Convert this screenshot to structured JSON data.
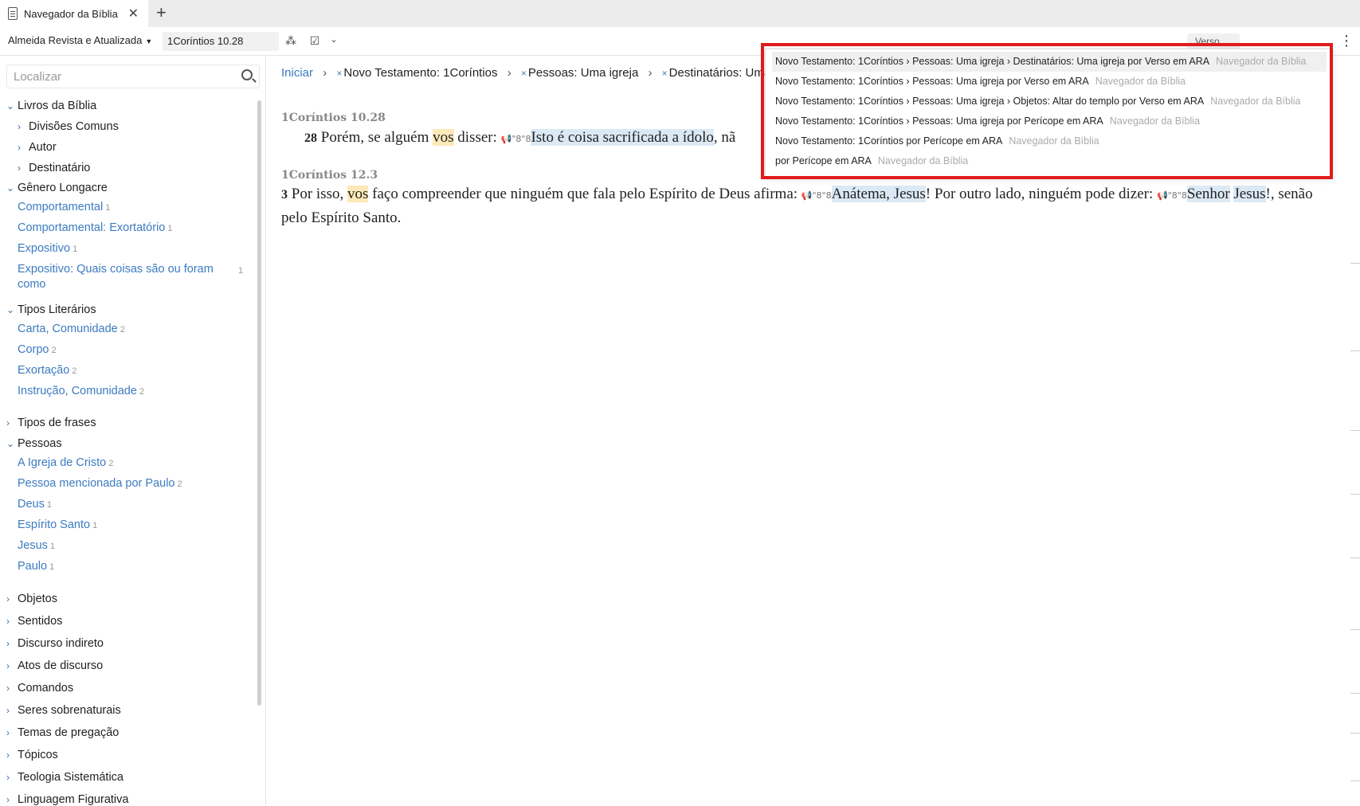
{
  "tab": {
    "title": "Navegador da Bíblia",
    "close": "✕",
    "new_tab": "+"
  },
  "toolbar": {
    "bible_version": "Almeida Revista e Atualizada",
    "reference": "1Coríntios 10.28",
    "verse_button": "Verso"
  },
  "sidebar": {
    "search_placeholder": "Localizar",
    "tree": [
      {
        "label": "Livros da Bíblia",
        "expanded": true
      },
      {
        "label": "Divisões Comuns",
        "expanded": false
      },
      {
        "label": "Autor",
        "expanded": false
      },
      {
        "label": "Destinatário",
        "expanded": false
      },
      {
        "label": "Gênero Longacre",
        "expanded": true
      },
      {
        "label": "Tipos Literários",
        "expanded": true
      },
      {
        "label": "Tipos de frases",
        "expanded": false
      },
      {
        "label": "Pessoas",
        "expanded": true
      },
      {
        "label": "Objetos",
        "expanded": false
      },
      {
        "label": "Sentidos",
        "expanded": false
      },
      {
        "label": "Discurso indireto",
        "expanded": false
      },
      {
        "label": "Atos de discurso",
        "expanded": false
      },
      {
        "label": "Comandos",
        "expanded": false
      },
      {
        "label": "Seres sobrenaturais",
        "expanded": false
      },
      {
        "label": "Temas de pregação",
        "expanded": false
      },
      {
        "label": "Tópicos",
        "expanded": false
      },
      {
        "label": "Teologia Sistemática",
        "expanded": false
      },
      {
        "label": "Linguagem Figurativa",
        "expanded": false
      }
    ],
    "leaves": [
      {
        "label": "Comportamental",
        "count": "1"
      },
      {
        "label": "Comportamental: Exortatório",
        "count": "1"
      },
      {
        "label": "Expositivo",
        "count": "1"
      },
      {
        "label": "Expositivo: Quais coisas são ou foram como",
        "count": "1"
      },
      {
        "label": "Carta, Comunidade",
        "count": "2"
      },
      {
        "label": "Corpo",
        "count": "2"
      },
      {
        "label": "Exortação",
        "count": "2"
      },
      {
        "label": "Instrução, Comunidade",
        "count": "2"
      },
      {
        "label": "A Igreja de Cristo",
        "count": "2"
      },
      {
        "label": "Pessoa mencionada por Paulo",
        "count": "2"
      },
      {
        "label": "Deus",
        "count": "1"
      },
      {
        "label": "Espírito Santo",
        "count": "1"
      },
      {
        "label": "Jesus",
        "count": "1"
      },
      {
        "label": "Paulo",
        "count": "1"
      }
    ]
  },
  "breadcrumb": {
    "home": "Iniciar",
    "items": [
      "Novo Testamento: 1Coríntios",
      "Pessoas: Uma igreja",
      "Destinatários: Uma igre"
    ]
  },
  "passages": [
    {
      "reference": "1Coríntios 10.28",
      "verse_number": "28",
      "pre": "Porém, se alguém ",
      "highlight_word": "vos",
      "mid": " disser: ",
      "speech_icon": "📢\"8\"8",
      "quote": "Isto é coisa sacrificada a ídolo",
      "post": ", nã"
    },
    {
      "reference": "1Coríntios 12.3",
      "verse_number": "3",
      "pre": "Por isso, ",
      "highlight_word": "vos",
      "mid": " faço compreender que ninguém que fala pelo Espírito de Deus afirma: ",
      "speech_icon": "📢\"8\"8",
      "quote": "Anátema, Jesus",
      "mid2": "! Por outro lado, ninguém pode dizer: ",
      "quote2a": "Senhor",
      "quote2b": "Jesus",
      "post": "!, senão pelo Espírito Santo."
    }
  ],
  "dropdown": {
    "items": [
      {
        "text": "Novo Testamento: 1Coríntios › Pessoas: Uma igreja › Destinatários: Uma igreja por Verso em ARA",
        "source": "Navegador da Bíblia",
        "selected": true
      },
      {
        "text": "Novo Testamento: 1Coríntios › Pessoas: Uma igreja por Verso em ARA",
        "source": "Navegador da Bíblia",
        "selected": false
      },
      {
        "text": "Novo Testamento: 1Coríntios › Pessoas: Uma igreja › Objetos: Altar do templo por Verso em ARA",
        "source": "Navegador da Bíblia",
        "selected": false
      },
      {
        "text": "Novo Testamento: 1Coríntios › Pessoas: Uma igreja por Perícope em ARA",
        "source": "Navegador da Bíblia",
        "selected": false
      },
      {
        "text": "Novo Testamento: 1Coríntios por Perícope em ARA",
        "source": "Navegador da Bíblia",
        "selected": false
      },
      {
        "text": "por Perícope em ARA",
        "source": "Navegador da Bíblia",
        "selected": false
      }
    ]
  },
  "colors": {
    "link": "#3b7bc0",
    "highlight_word": "#fde9b8",
    "highlight_quote": "#dbe9f5",
    "annotation_frame": "#e01b1b"
  }
}
